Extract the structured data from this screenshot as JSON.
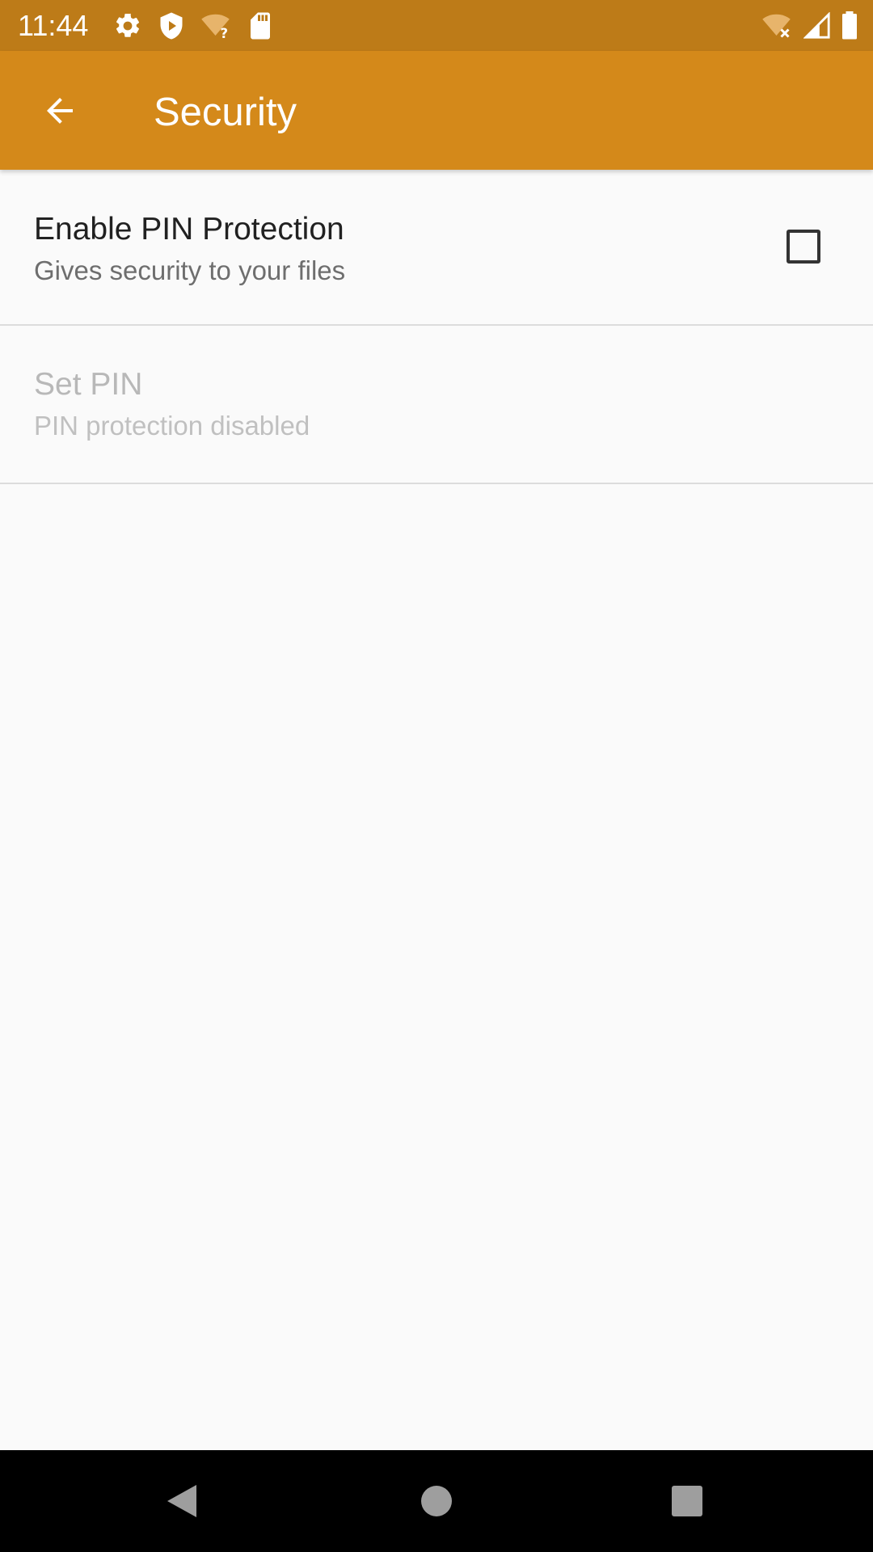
{
  "status_bar": {
    "time": "11:44",
    "left_icons": [
      "settings-gear-icon",
      "shield-play-icon",
      "wifi-question-icon",
      "sd-card-icon"
    ],
    "right_icons": [
      "wifi-off-icon",
      "cellular-signal-icon",
      "battery-icon"
    ],
    "background": "#bd7b18"
  },
  "app_bar": {
    "title": "Security",
    "back_icon": "arrow-left-icon",
    "background": "#d4891a"
  },
  "preferences": [
    {
      "title": "Enable PIN Protection",
      "summary": "Gives security to your files",
      "checked": false,
      "enabled": true
    },
    {
      "title": "Set PIN",
      "summary": "PIN protection disabled",
      "enabled": false
    }
  ],
  "nav_bar": {
    "buttons": [
      "back-triangle-icon",
      "home-circle-icon",
      "recents-square-icon"
    ]
  }
}
